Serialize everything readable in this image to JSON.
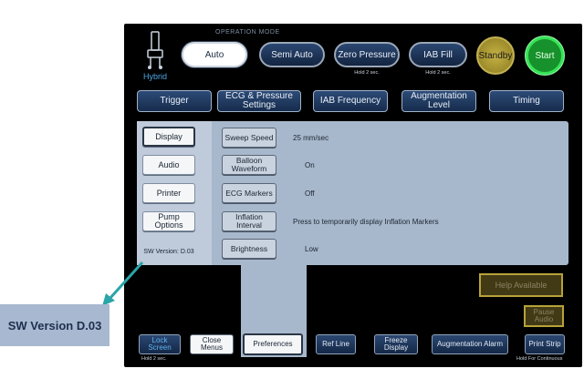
{
  "operation_mode": {
    "title": "OPERATION MODE",
    "auto": "Auto",
    "semi_auto": "Semi Auto",
    "zero_pressure": "Zero Pressure",
    "zero_pressure_hold": "Hold 2 sec.",
    "iab_fill": "IAB Fill",
    "iab_fill_hold": "Hold 2 sec.",
    "standby": "Standby",
    "start": "Start"
  },
  "logo": {
    "label": "Hybrid"
  },
  "tabs": [
    "Trigger",
    "ECG & Pressure Settings",
    "IAB Frequency",
    "Augmentation Level",
    "Timing"
  ],
  "sidebar": {
    "items": [
      "Display",
      "Audio",
      "Printer",
      "Pump Options"
    ],
    "sw_version": "SW Version: D.03"
  },
  "settings": [
    {
      "label": "Sweep Speed",
      "value": "25 mm/sec"
    },
    {
      "label": "Balloon Waveform",
      "value": "On"
    },
    {
      "label": "ECG Markers",
      "value": "Off"
    },
    {
      "label": "Inflation Interval",
      "value": "Press to temporarily display Inflation Markers"
    },
    {
      "label": "Brightness",
      "value": "Low"
    }
  ],
  "side_controls": {
    "help": "Help Available",
    "pause_audio": "Pause Audio"
  },
  "bottom_bar": {
    "lock_screen": "Lock Screen",
    "lock_hold": "Hold 2 sec.",
    "close_menus": "Close Menus",
    "preferences": "Preferences",
    "ref_line": "Ref Line",
    "freeze_display": "Freeze Display",
    "augmentation_alarm": "Augmentation Alarm",
    "print_strip": "Print Strip",
    "print_hold": "Hold For Continuous"
  },
  "callout": {
    "text": "SW Version D.03"
  },
  "colors": {
    "accent_blue": "#4da6e6",
    "start_green": "#16912b",
    "standby_gold": "#c6b246",
    "callout_arrow": "#2aa5a9"
  }
}
